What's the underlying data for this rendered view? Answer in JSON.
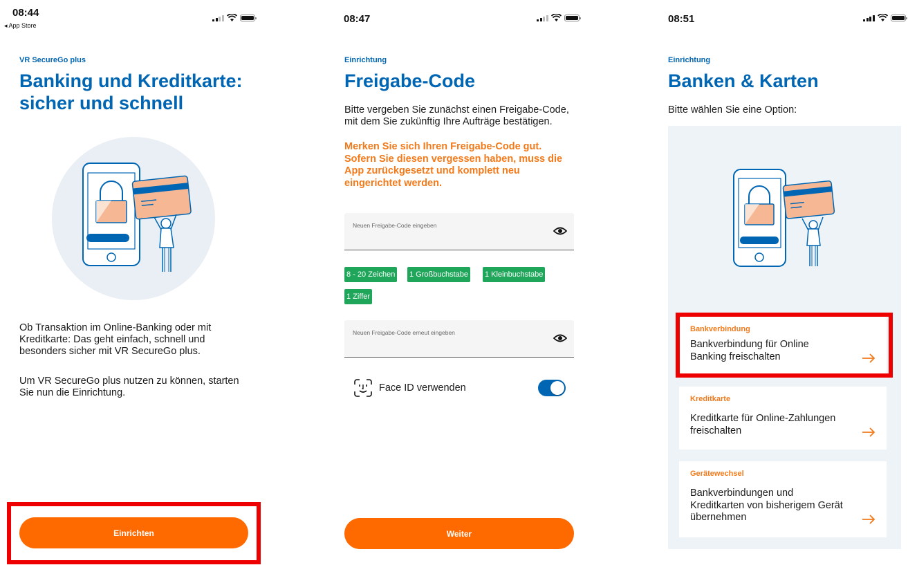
{
  "screen1": {
    "status": {
      "time": "08:44",
      "back_label": "◂ App Store"
    },
    "eyebrow": "VR SecureGo plus",
    "title_line1": "Banking und Kreditkarte:",
    "title_line2": "sicher und schnell",
    "para1_line1": "Ob Transaktion im Online-Banking oder mit",
    "para1_line2": "Kreditkarte: Das geht einfach, schnell und",
    "para1_line3": "besonders sicher mit VR SecureGo plus.",
    "para2_line1": "Um VR SecureGo plus nutzen zu können, starten",
    "para2_line2": "Sie nun die Einrichtung.",
    "cta_label": "Einrichten"
  },
  "screen2": {
    "status": {
      "time": "08:47"
    },
    "eyebrow": "Einrichtung",
    "title": "Freigabe-Code",
    "intro_line1": "Bitte vergeben Sie zunächst einen Freigabe-Code,",
    "intro_line2": "mit dem Sie zukünftig Ihre Aufträge bestätigen.",
    "warning_line1": "Merken Sie sich Ihren Freigabe-Code gut.",
    "warning_line2": "Sofern Sie diesen vergessen haben, muss die",
    "warning_line3": "App zurückgesetzt und komplett neu",
    "warning_line4": "eingerichtet werden.",
    "field1_label": "Neuen Freigabe-Code eingeben",
    "field2_label": "Neuen Freigabe-Code erneut eingeben",
    "rules": [
      "8 - 20 Zeichen",
      "1 Großbuchstabe",
      "1 Kleinbuchstabe",
      "1 Ziffer"
    ],
    "rule_color": "#1fa65a",
    "faceid_label": "Face ID verwenden",
    "faceid_enabled": true,
    "cta_label": "Weiter"
  },
  "screen3": {
    "status": {
      "time": "08:51"
    },
    "eyebrow": "Einrichtung",
    "title": "Banken & Karten",
    "prompt": "Bitte wählen Sie eine Option:",
    "options": [
      {
        "eyebrow": "Bankverbindung",
        "line1": "Bankverbindung für Online",
        "line2": "Banking freischalten",
        "line3": ""
      },
      {
        "eyebrow": "Kreditkarte",
        "line1": "Kreditkarte für Online-Zahlungen",
        "line2": "freischalten",
        "line3": ""
      },
      {
        "eyebrow": "Gerätewechsel",
        "line1": "Bankverbindungen und",
        "line2": "Kreditkarten von bisherigem Gerät",
        "line3": "übernehmen"
      }
    ]
  },
  "colors": {
    "brand_blue": "#0066b3",
    "accent_orange": "#ff6a00",
    "warning_orange": "#f27a1a",
    "highlight_red": "#ee0000"
  }
}
